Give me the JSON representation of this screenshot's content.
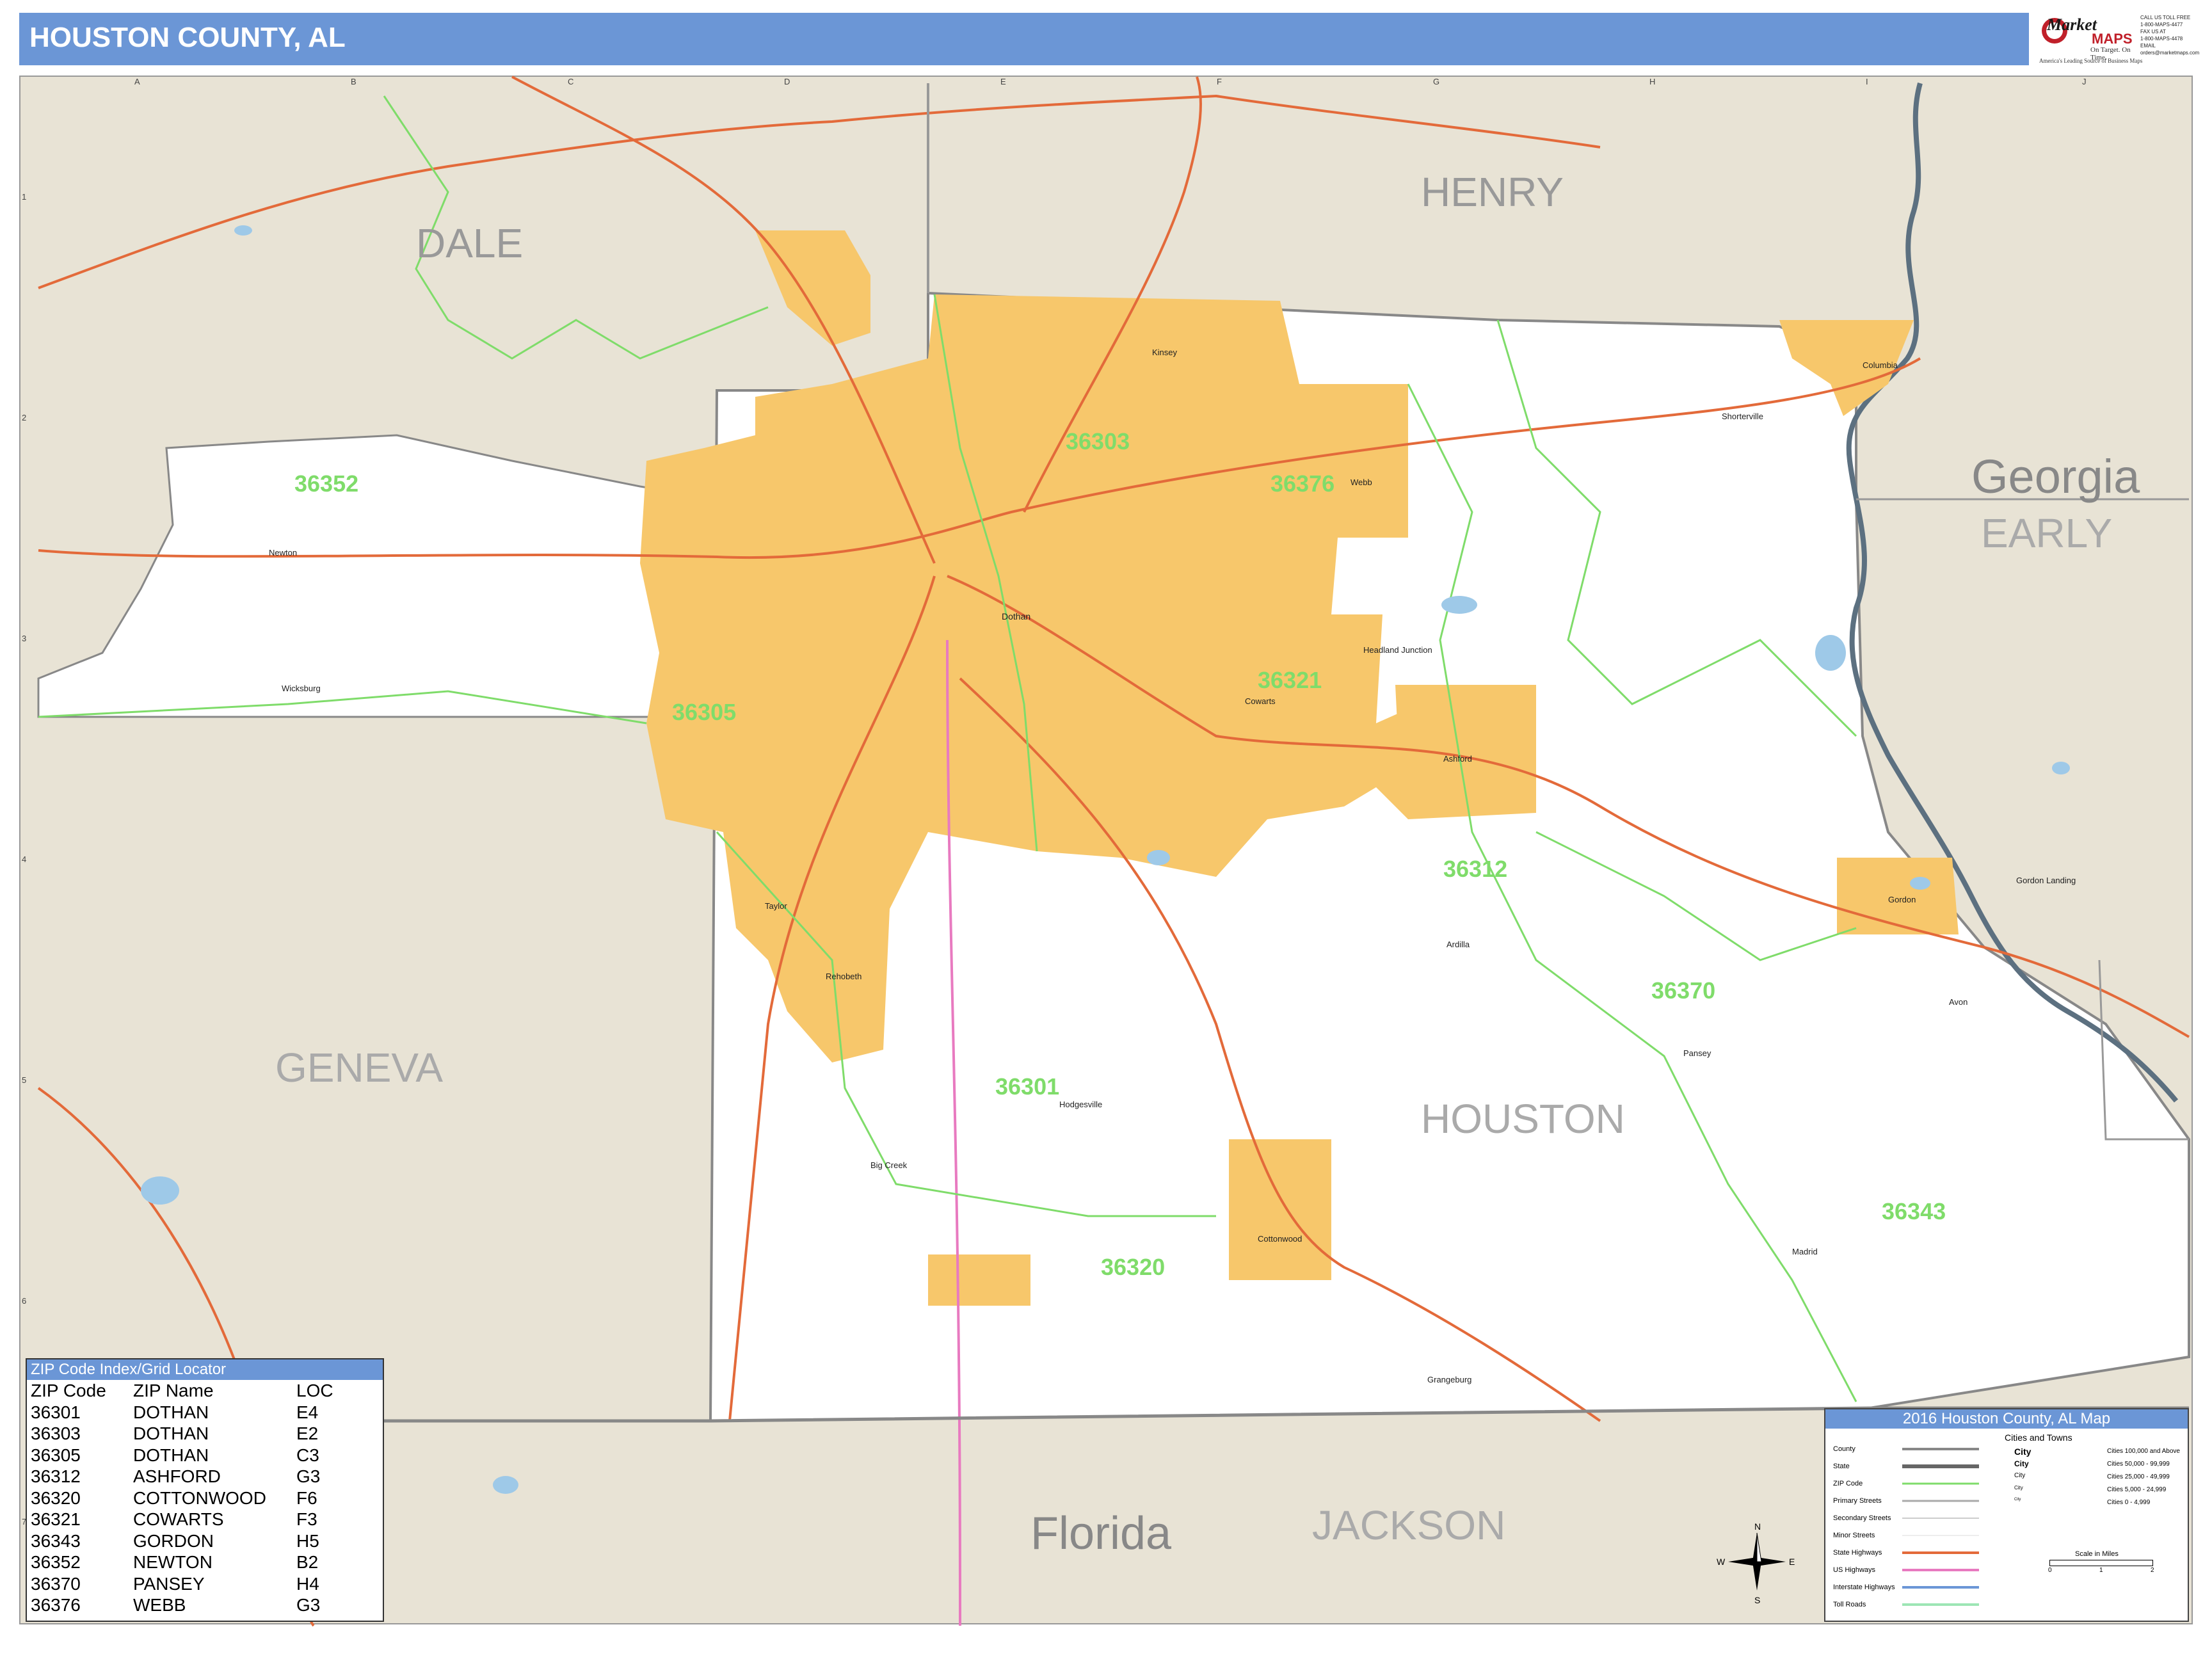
{
  "header": {
    "title": "HOUSTON COUNTY, AL"
  },
  "logo": {
    "name": "Market",
    "brand": "MAPS",
    "tagline": "On Target. On Time.",
    "subline": "America's Leading Source of Business Maps"
  },
  "contact": {
    "lines": [
      "CALL US TOLL FREE",
      "1-800-MAPS-4477",
      "FAX US AT",
      "1-800-MAPS-4478",
      "EMAIL",
      "orders@marketmaps.com"
    ]
  },
  "grid": {
    "columns": [
      "A",
      "B",
      "C",
      "D",
      "E",
      "F",
      "G",
      "H",
      "I",
      "J"
    ],
    "rows": [
      "1",
      "2",
      "3",
      "4",
      "5",
      "6",
      "7"
    ]
  },
  "regions": {
    "henry": "HENRY",
    "dale": "DALE",
    "georgia": "Georgia",
    "early": "EARLY",
    "geneva": "GENEVA",
    "houston": "HOUSTON",
    "florida": "Florida",
    "jackson": "JACKSON"
  },
  "zip_labels": [
    "36303",
    "36376",
    "36352",
    "36305",
    "36321",
    "36312",
    "36370",
    "36301",
    "36343",
    "36320"
  ],
  "towns": [
    "Dothan",
    "Ashford",
    "Cottonwood",
    "Cowarts",
    "Gordon",
    "Newton",
    "Pansey",
    "Webb",
    "Columbia",
    "Taylor",
    "Rehobeth",
    "Kinsey",
    "Avon",
    "Madrid",
    "Headland Junction",
    "Wicksburg",
    "Hodgesville",
    "Big Creek",
    "Grangeburg",
    "Cottonwood",
    "Ardilla",
    "Gordon Landing",
    "Shorterville"
  ],
  "zip_index": {
    "title": "ZIP Code Index/Grid Locator",
    "columns": [
      "ZIP Code",
      "ZIP Name",
      "LOC"
    ],
    "rows": [
      [
        "36301",
        "DOTHAN",
        "E4"
      ],
      [
        "36303",
        "DOTHAN",
        "E2"
      ],
      [
        "36305",
        "DOTHAN",
        "C3"
      ],
      [
        "36312",
        "ASHFORD",
        "G3"
      ],
      [
        "36320",
        "COTTONWOOD",
        "F6"
      ],
      [
        "36321",
        "COWARTS",
        "F3"
      ],
      [
        "36343",
        "GORDON",
        "H5"
      ],
      [
        "36352",
        "NEWTON",
        "B2"
      ],
      [
        "36370",
        "PANSEY",
        "H4"
      ],
      [
        "36376",
        "WEBB",
        "G3"
      ]
    ]
  },
  "legend": {
    "title": "2016 Houston County, AL Map",
    "cities_header": "Cities and Towns",
    "items": [
      "County",
      "State",
      "ZIP Code",
      "Primary Streets",
      "Secondary Streets",
      "Minor Streets",
      "State Highways",
      "US Highways",
      "Interstate Highways",
      "Toll Roads"
    ],
    "cities": [
      {
        "label": "City",
        "range": "Cities 100,000 and Above"
      },
      {
        "label": "City",
        "range": "Cities 50,000 - 99,999"
      },
      {
        "label": "City",
        "range": "Cities 25,000 - 49,999"
      },
      {
        "label": "City",
        "range": "Cities 5,000 - 24,999"
      },
      {
        "label": "City",
        "range": "Cities 0 - 4,999"
      }
    ],
    "scale_label": "Scale in Miles",
    "scale_ticks": [
      "0",
      "1",
      "2"
    ]
  },
  "compass": {
    "n": "N",
    "s": "S",
    "e": "E",
    "w": "W"
  },
  "colors": {
    "title_bar": "#6b96d6",
    "outside_land": "#e8e3d5",
    "county_land": "#ffffff",
    "city_fill": "#f7c76b",
    "zip_boundary": "#7fdc6a",
    "highway": "#e36a3a",
    "us_highway": "#e87ac0",
    "river": "#5c7080",
    "water": "#9ec9e8"
  }
}
